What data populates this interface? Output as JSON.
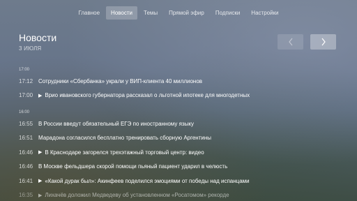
{
  "nav": {
    "items": [
      {
        "label": "Главное",
        "active": false
      },
      {
        "label": "Новости",
        "active": true
      },
      {
        "label": "Темы",
        "active": false
      },
      {
        "label": "Прямой эфир",
        "active": false
      },
      {
        "label": "Подписки",
        "active": false
      },
      {
        "label": "Настройки",
        "active": false
      }
    ]
  },
  "page": {
    "title": "Новости",
    "date": "3 ИЮЛЯ"
  },
  "groups": [
    {
      "hour": "17:00",
      "items": [
        {
          "time": "17:12",
          "video": false,
          "text": "Сотрудники «Сбербанка» украли у ВИП-клиента 40 миллионов"
        },
        {
          "time": "17:00",
          "video": true,
          "text": "Врио ивановского губернатора рассказал о льготной ипотеке для многодетных"
        }
      ]
    },
    {
      "hour": "16:00",
      "items": [
        {
          "time": "16:55",
          "video": false,
          "text": "В России введут обязательный ЕГЭ по иностранному языку"
        },
        {
          "time": "16:51",
          "video": false,
          "text": "Марадона согласился бесплатно тренировать сборную Аргентины"
        },
        {
          "time": "16:46",
          "video": true,
          "text": "В Краснодаре загорелся трехэтажный торговый центр: видео"
        },
        {
          "time": "16:46",
          "video": false,
          "text": "В Москве фельдшера скорой помощи пьяный пациент ударил в челюсть"
        },
        {
          "time": "16:41",
          "video": true,
          "text": "«Какой дурак был»: Акинфеев поделился эмоциями от победы над испанцами"
        },
        {
          "time": "16:35",
          "video": true,
          "text": "Лихачёв доложил Медведеву об установленном «Росатомом» рекорде"
        }
      ]
    }
  ],
  "icons": {
    "play": "▶",
    "prev": "chevron-left-icon",
    "next": "chevron-right-icon"
  }
}
